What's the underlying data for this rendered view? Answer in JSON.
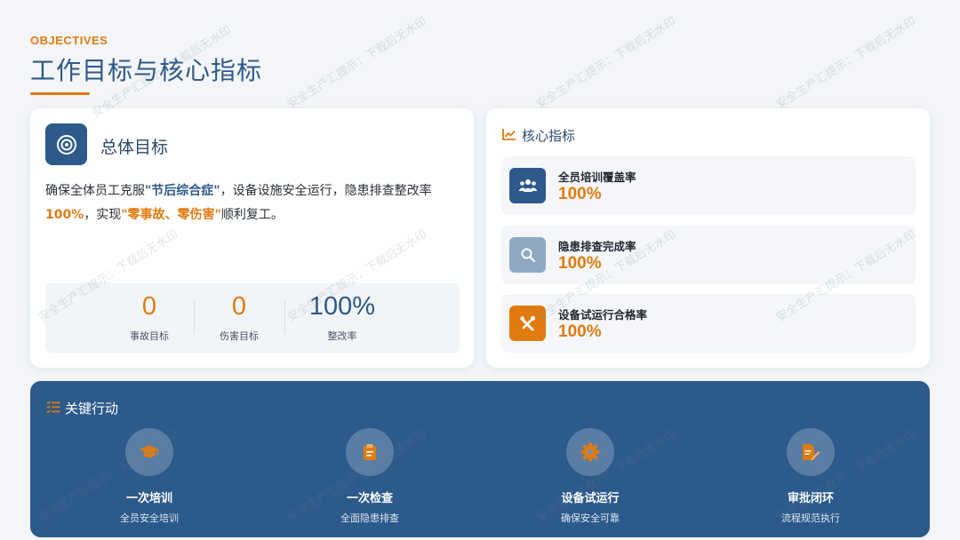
{
  "header": {
    "eyebrow": "OBJECTIVES",
    "title": "工作目标与核心指标"
  },
  "goal": {
    "icon": "target-icon",
    "title": "总体目标",
    "text_parts": {
      "p1": "确保全体员工克服",
      "p2": "\"节后综合症\"",
      "p3": "，设备设施安全运行，隐患排查整改率",
      "p4": "100%",
      "p5": "，实现",
      "p6": "\"零事故、零伤害\"",
      "p7": "顺利复工。"
    },
    "stats": [
      {
        "value": "0",
        "label": "事故目标"
      },
      {
        "value": "0",
        "label": "伤害目标"
      },
      {
        "value": "100%",
        "label": "整改率"
      }
    ]
  },
  "kpi": {
    "icon": "line-chart-icon",
    "title": "核心指标",
    "items": [
      {
        "icon": "users-icon",
        "label": "全员培训覆盖率",
        "value": "100%",
        "icon_color": "#2d5a8a"
      },
      {
        "icon": "search-icon",
        "label": "隐患排查完成率",
        "value": "100%",
        "icon_color": "#8fa8c4"
      },
      {
        "icon": "tools-icon",
        "label": "设备试运行合格率",
        "value": "100%",
        "icon_color": "#e07b10"
      }
    ]
  },
  "actions": {
    "icon": "list-check-icon",
    "title": "关键行动",
    "items": [
      {
        "icon": "graduation-cap-icon",
        "title": "一次培训",
        "subtitle": "全员安全培训"
      },
      {
        "icon": "clipboard-icon",
        "title": "一次检查",
        "subtitle": "全面隐患排查"
      },
      {
        "icon": "gear-icon",
        "title": "设备试运行",
        "subtitle": "确保安全可靠"
      },
      {
        "icon": "document-sign-icon",
        "title": "审批闭环",
        "subtitle": "流程规范执行"
      }
    ]
  },
  "watermark": "安全生产汇提示：下载后无水印",
  "colors": {
    "accent": "#e07b10",
    "primary": "#2d5a8a",
    "background": "#f3f5f8"
  }
}
